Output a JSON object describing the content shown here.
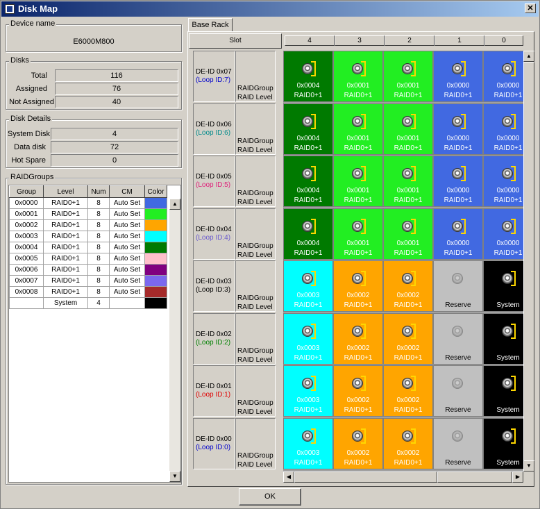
{
  "window": {
    "title": "Disk Map",
    "close_glyph": "✕"
  },
  "device": {
    "group_label": "Device name",
    "name": "E6000M800"
  },
  "disks": {
    "group_label": "Disks",
    "rows": [
      {
        "label": "Total",
        "value": "116"
      },
      {
        "label": "Assigned",
        "value": "76"
      },
      {
        "label": "Not Assigned",
        "value": "40"
      }
    ]
  },
  "disk_details": {
    "group_label": "Disk Details",
    "rows": [
      {
        "label": "System Disk",
        "value": "4"
      },
      {
        "label": "Data disk",
        "value": "72"
      },
      {
        "label": "Hot Spare",
        "value": "0"
      }
    ]
  },
  "raidgroups": {
    "group_label": "RAIDGroups",
    "headers": [
      "Group",
      "Level",
      "Num",
      "CM",
      "Color"
    ],
    "rows": [
      {
        "group": "0x0000",
        "level": "RAID0+1",
        "num": "8",
        "cm": "Auto Set",
        "color": "#4169e1"
      },
      {
        "group": "0x0001",
        "level": "RAID0+1",
        "num": "8",
        "cm": "Auto Set",
        "color": "#22ee22"
      },
      {
        "group": "0x0002",
        "level": "RAID0+1",
        "num": "8",
        "cm": "Auto Set",
        "color": "#ffa500"
      },
      {
        "group": "0x0003",
        "level": "RAID0+1",
        "num": "8",
        "cm": "Auto Set",
        "color": "#00ffff"
      },
      {
        "group": "0x0004",
        "level": "RAID0+1",
        "num": "8",
        "cm": "Auto Set",
        "color": "#007a00"
      },
      {
        "group": "0x0005",
        "level": "RAID0+1",
        "num": "8",
        "cm": "Auto Set",
        "color": "#ffc0cb"
      },
      {
        "group": "0x0006",
        "level": "RAID0+1",
        "num": "8",
        "cm": "Auto Set",
        "color": "#800080"
      },
      {
        "group": "0x0007",
        "level": "RAID0+1",
        "num": "8",
        "cm": "Auto Set",
        "color": "#7b68ee"
      },
      {
        "group": "0x0008",
        "level": "RAID0+1",
        "num": "8",
        "cm": "Auto Set",
        "color": "#a52a2a"
      },
      {
        "group": "",
        "level": "System",
        "num": "4",
        "cm": "",
        "color": "#000000"
      }
    ]
  },
  "rack": {
    "tab_label": "Base Rack",
    "slot_label": "Slot",
    "columns": [
      "4",
      "3",
      "2",
      "1",
      "0"
    ],
    "row_label_1": "RAIDGroup",
    "row_label_2": "RAID Level",
    "rows": [
      {
        "de_id": "DE-ID 0x07",
        "loop": "(Loop ID:7)",
        "loop_color": "#0000cc",
        "cells": [
          {
            "g": "0x0004",
            "l": "RAID0+1",
            "bg": "#007a00",
            "fg": "#ffffff",
            "icon": "disk"
          },
          {
            "g": "0x0001",
            "l": "RAID0+1",
            "bg": "#22ee22",
            "fg": "#ffffff",
            "icon": "disk"
          },
          {
            "g": "0x0001",
            "l": "RAID0+1",
            "bg": "#22ee22",
            "fg": "#ffffff",
            "icon": "disk"
          },
          {
            "g": "0x0000",
            "l": "RAID0+1",
            "bg": "#4169e1",
            "fg": "#ffffff",
            "icon": "disk"
          },
          {
            "g": "0x0000",
            "l": "RAID0+1",
            "bg": "#4169e1",
            "fg": "#ffffff",
            "icon": "disk"
          }
        ]
      },
      {
        "de_id": "DE-ID 0x06",
        "loop": "(Loop ID:6)",
        "loop_color": "#008b8b",
        "cells": [
          {
            "g": "0x0004",
            "l": "RAID0+1",
            "bg": "#007a00",
            "fg": "#ffffff",
            "icon": "disk"
          },
          {
            "g": "0x0001",
            "l": "RAID0+1",
            "bg": "#22ee22",
            "fg": "#ffffff",
            "icon": "disk"
          },
          {
            "g": "0x0001",
            "l": "RAID0+1",
            "bg": "#22ee22",
            "fg": "#ffffff",
            "icon": "disk"
          },
          {
            "g": "0x0000",
            "l": "RAID0+1",
            "bg": "#4169e1",
            "fg": "#ffffff",
            "icon": "disk"
          },
          {
            "g": "0x0000",
            "l": "RAID0+1",
            "bg": "#4169e1",
            "fg": "#ffffff",
            "icon": "disk"
          }
        ]
      },
      {
        "de_id": "DE-ID 0x05",
        "loop": "(Loop ID:5)",
        "loop_color": "#e0207a",
        "cells": [
          {
            "g": "0x0004",
            "l": "RAID0+1",
            "bg": "#007a00",
            "fg": "#ffffff",
            "icon": "disk"
          },
          {
            "g": "0x0001",
            "l": "RAID0+1",
            "bg": "#22ee22",
            "fg": "#ffffff",
            "icon": "disk"
          },
          {
            "g": "0x0001",
            "l": "RAID0+1",
            "bg": "#22ee22",
            "fg": "#ffffff",
            "icon": "disk"
          },
          {
            "g": "0x0000",
            "l": "RAID0+1",
            "bg": "#4169e1",
            "fg": "#ffffff",
            "icon": "disk"
          },
          {
            "g": "0x0000",
            "l": "RAID0+1",
            "bg": "#4169e1",
            "fg": "#ffffff",
            "icon": "disk"
          }
        ]
      },
      {
        "de_id": "DE-ID 0x04",
        "loop": "(Loop ID:4)",
        "loop_color": "#6a5acd",
        "cells": [
          {
            "g": "0x0004",
            "l": "RAID0+1",
            "bg": "#007a00",
            "fg": "#ffffff",
            "icon": "disk"
          },
          {
            "g": "0x0001",
            "l": "RAID0+1",
            "bg": "#22ee22",
            "fg": "#ffffff",
            "icon": "disk"
          },
          {
            "g": "0x0001",
            "l": "RAID0+1",
            "bg": "#22ee22",
            "fg": "#ffffff",
            "icon": "disk"
          },
          {
            "g": "0x0000",
            "l": "RAID0+1",
            "bg": "#4169e1",
            "fg": "#ffffff",
            "icon": "disk"
          },
          {
            "g": "0x0000",
            "l": "RAID0+1",
            "bg": "#4169e1",
            "fg": "#ffffff",
            "icon": "disk"
          }
        ]
      },
      {
        "de_id": "DE-ID 0x03",
        "loop": "(Loop ID:3)",
        "loop_color": "#000000",
        "cells": [
          {
            "g": "0x0003",
            "l": "RAID0+1",
            "bg": "#00ffff",
            "fg": "#ffffff",
            "icon": "disk"
          },
          {
            "g": "0x0002",
            "l": "RAID0+1",
            "bg": "#ffa500",
            "fg": "#ffffff",
            "icon": "disk"
          },
          {
            "g": "0x0002",
            "l": "RAID0+1",
            "bg": "#ffa500",
            "fg": "#ffffff",
            "icon": "disk"
          },
          {
            "g": "",
            "l": "Reserve",
            "bg": "#c0c0c0",
            "fg": "#000000",
            "icon": "grey"
          },
          {
            "g": "",
            "l": "System",
            "bg": "#000000",
            "fg": "#ffffff",
            "icon": "disk"
          }
        ]
      },
      {
        "de_id": "DE-ID 0x02",
        "loop": "(Loop ID:2)",
        "loop_color": "#008000",
        "cells": [
          {
            "g": "0x0003",
            "l": "RAID0+1",
            "bg": "#00ffff",
            "fg": "#ffffff",
            "icon": "disk"
          },
          {
            "g": "0x0002",
            "l": "RAID0+1",
            "bg": "#ffa500",
            "fg": "#ffffff",
            "icon": "disk"
          },
          {
            "g": "0x0002",
            "l": "RAID0+1",
            "bg": "#ffa500",
            "fg": "#ffffff",
            "icon": "disk"
          },
          {
            "g": "",
            "l": "Reserve",
            "bg": "#c0c0c0",
            "fg": "#000000",
            "icon": "grey"
          },
          {
            "g": "",
            "l": "System",
            "bg": "#000000",
            "fg": "#ffffff",
            "icon": "disk"
          }
        ]
      },
      {
        "de_id": "DE-ID 0x01",
        "loop": "(Loop ID:1)",
        "loop_color": "#e00000",
        "cells": [
          {
            "g": "0x0003",
            "l": "RAID0+1",
            "bg": "#00ffff",
            "fg": "#ffffff",
            "icon": "disk"
          },
          {
            "g": "0x0002",
            "l": "RAID0+1",
            "bg": "#ffa500",
            "fg": "#ffffff",
            "icon": "disk"
          },
          {
            "g": "0x0002",
            "l": "RAID0+1",
            "bg": "#ffa500",
            "fg": "#ffffff",
            "icon": "disk"
          },
          {
            "g": "",
            "l": "Reserve",
            "bg": "#c0c0c0",
            "fg": "#000000",
            "icon": "grey"
          },
          {
            "g": "",
            "l": "System",
            "bg": "#000000",
            "fg": "#ffffff",
            "icon": "disk"
          }
        ]
      },
      {
        "de_id": "DE-ID 0x00",
        "loop": "(Loop ID:0)",
        "loop_color": "#0000cc",
        "cells": [
          {
            "g": "0x0003",
            "l": "RAID0+1",
            "bg": "#00ffff",
            "fg": "#ffffff",
            "icon": "disk"
          },
          {
            "g": "0x0002",
            "l": "RAID0+1",
            "bg": "#ffa500",
            "fg": "#ffffff",
            "icon": "disk"
          },
          {
            "g": "0x0002",
            "l": "RAID0+1",
            "bg": "#ffa500",
            "fg": "#ffffff",
            "icon": "disk"
          },
          {
            "g": "",
            "l": "Reserve",
            "bg": "#c0c0c0",
            "fg": "#000000",
            "icon": "grey"
          },
          {
            "g": "",
            "l": "System",
            "bg": "#000000",
            "fg": "#ffffff",
            "icon": "disk"
          }
        ]
      }
    ]
  },
  "ok_label": "OK"
}
